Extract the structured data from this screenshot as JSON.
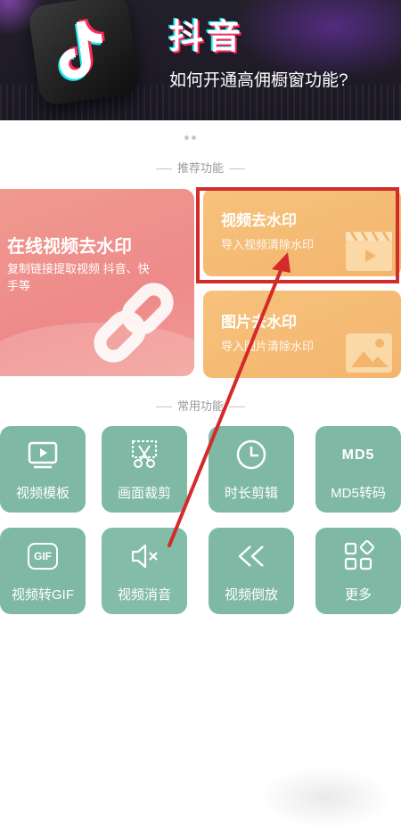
{
  "banner": {
    "app_name": "抖音",
    "subtitle": "如何开通高佣橱窗功能?"
  },
  "sections": {
    "recommended": "推荐功能",
    "common": "常用功能"
  },
  "cards": {
    "online": {
      "title": "在线视频去水印",
      "desc": "复制链接提取视频 抖音、快手等"
    },
    "video": {
      "title": "视频去水印",
      "desc": "导入视频清除水印"
    },
    "image": {
      "title": "图片去水印",
      "desc": "导入图片清除水印"
    }
  },
  "tiles": [
    {
      "label": "视频模板",
      "icon": "video-template-icon"
    },
    {
      "label": "画面裁剪",
      "icon": "scissors-icon"
    },
    {
      "label": "时长剪辑",
      "icon": "clock-icon"
    },
    {
      "label": "MD5转码",
      "icon": "md5-icon",
      "icon_text": "MD5"
    },
    {
      "label": "视频转GIF",
      "icon": "gif-icon",
      "icon_text": "GIF"
    },
    {
      "label": "视频消音",
      "icon": "mute-icon"
    },
    {
      "label": "视频倒放",
      "icon": "rewind-icon"
    },
    {
      "label": "更多",
      "icon": "more-grid-icon"
    }
  ],
  "colors": {
    "tile": "#7fb9a5",
    "online_card": "#ee8a8a",
    "orange_card": "#f3b56e",
    "highlight": "#d32a2a"
  }
}
